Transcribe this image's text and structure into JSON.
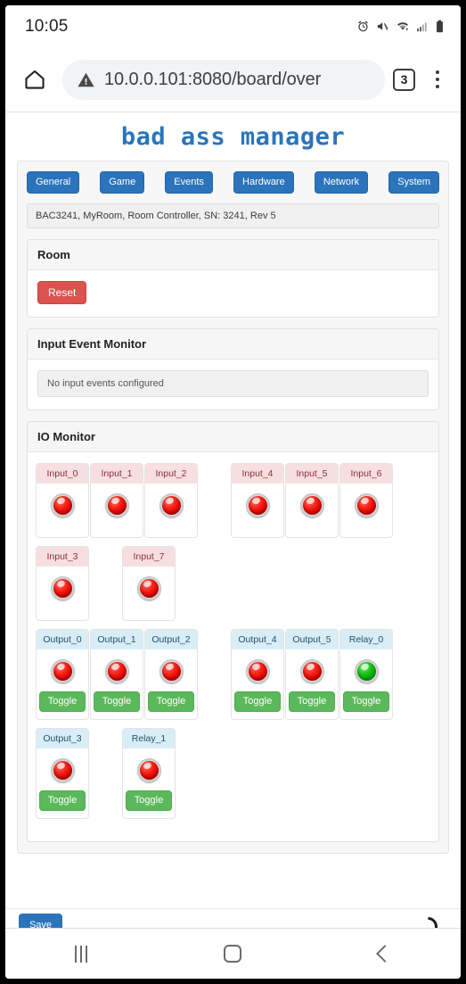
{
  "status_bar": {
    "time": "10:05",
    "icons": [
      "alarm-icon",
      "mute-vibrate-icon",
      "wifi-icon",
      "cellular-signal-icon",
      "battery-icon"
    ]
  },
  "browser": {
    "home_icon": "home-icon",
    "security_icon": "not-secure-warning-icon",
    "url": "10.0.0.101:8080/board/over",
    "url_host": "10.0.0.101",
    "url_path": ":8080/board/over",
    "tab_count": "3",
    "menu_icon": "kebab-menu-icon"
  },
  "page": {
    "title": "bad ass manager",
    "accent_color": "#2b74bb",
    "tabs": [
      {
        "label": "General"
      },
      {
        "label": "Game"
      },
      {
        "label": "Events"
      },
      {
        "label": "Hardware"
      },
      {
        "label": "Network"
      },
      {
        "label": "System"
      }
    ],
    "device_info": "BAC3241, MyRoom, Room Controller, SN: 3241, Rev 5",
    "room_card": {
      "title": "Room",
      "reset_label": "Reset",
      "reset_color": "#d9534f"
    },
    "input_event_card": {
      "title": "Input Event Monitor",
      "empty_message": "No input events configured"
    },
    "io_card": {
      "title": "IO Monitor",
      "rows": [
        {
          "groups": [
            {
              "cells": [
                {
                  "label": "Input_0",
                  "kind": "input",
                  "led": "red"
                },
                {
                  "label": "Input_1",
                  "kind": "input",
                  "led": "red"
                },
                {
                  "label": "Input_2",
                  "kind": "input",
                  "led": "red"
                }
              ]
            },
            {
              "cells": [
                {
                  "label": "Input_4",
                  "kind": "input",
                  "led": "red"
                },
                {
                  "label": "Input_5",
                  "kind": "input",
                  "led": "red"
                },
                {
                  "label": "Input_6",
                  "kind": "input",
                  "led": "red"
                }
              ]
            }
          ]
        },
        {
          "groups": [
            {
              "cells": [
                {
                  "label": "Input_3",
                  "kind": "input",
                  "led": "red"
                }
              ]
            },
            {
              "cells": [
                {
                  "label": "Input_7",
                  "kind": "input",
                  "led": "red"
                }
              ]
            }
          ]
        },
        {
          "toggles": true,
          "groups": [
            {
              "cells": [
                {
                  "label": "Output_0",
                  "kind": "output",
                  "led": "red",
                  "toggle": "Toggle"
                },
                {
                  "label": "Output_1",
                  "kind": "output",
                  "led": "red",
                  "toggle": "Toggle"
                },
                {
                  "label": "Output_2",
                  "kind": "output",
                  "led": "red",
                  "toggle": "Toggle"
                }
              ]
            },
            {
              "cells": [
                {
                  "label": "Output_4",
                  "kind": "output",
                  "led": "red",
                  "toggle": "Toggle"
                },
                {
                  "label": "Output_5",
                  "kind": "output",
                  "led": "red",
                  "toggle": "Toggle"
                },
                {
                  "label": "Relay_0",
                  "kind": "output",
                  "led": "green",
                  "toggle": "Toggle"
                }
              ]
            }
          ]
        },
        {
          "toggles": true,
          "groups": [
            {
              "cells": [
                {
                  "label": "Output_3",
                  "kind": "output",
                  "led": "red",
                  "toggle": "Toggle"
                }
              ]
            },
            {
              "cells": [
                {
                  "label": "Relay_1",
                  "kind": "output",
                  "led": "red",
                  "toggle": "Toggle"
                }
              ]
            }
          ]
        }
      ]
    },
    "footer": {
      "cut_button_label": "Save",
      "spinner_icon": "loading-spinner-icon"
    }
  },
  "android_nav": {
    "recents_icon": "recents-icon",
    "home_icon": "home-square-icon",
    "back_icon": "back-chevron-icon"
  }
}
